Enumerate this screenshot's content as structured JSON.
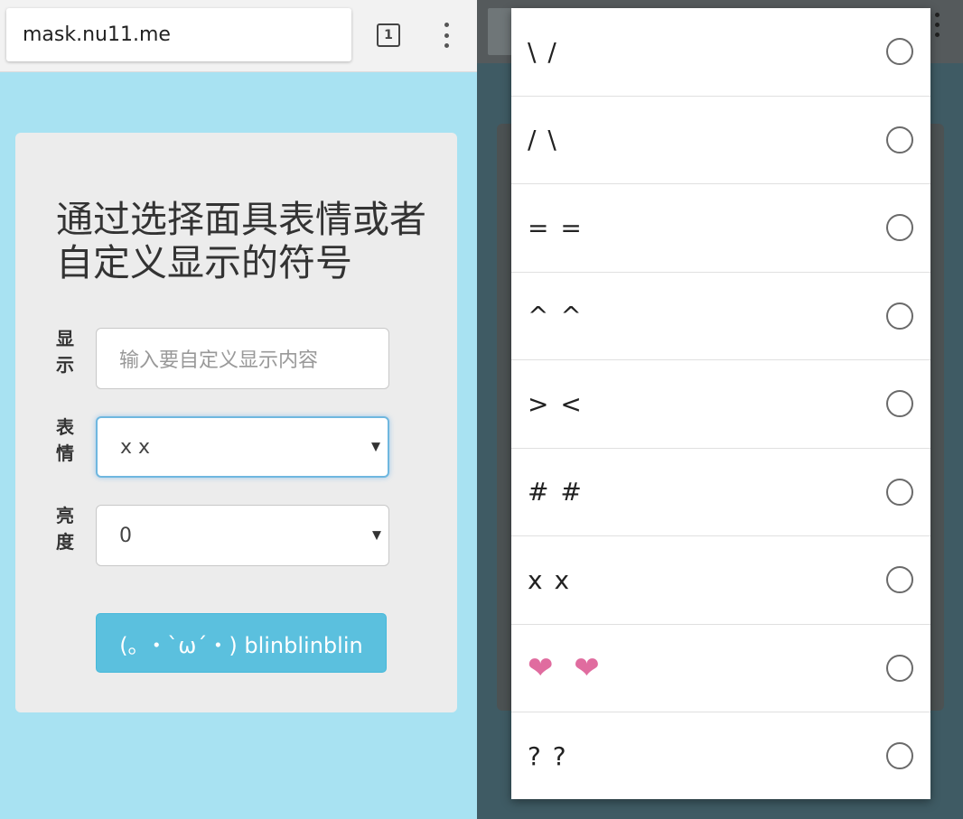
{
  "browser": {
    "url": "mask.nu11.me",
    "tab_count": "1"
  },
  "form": {
    "title": "通过选择面具表情或者自定义显示的符号",
    "display_label": "显示",
    "display_placeholder": "输入要自定义显示内容",
    "expression_label": "表情",
    "expression_value": "x x",
    "brightness_label": "亮度",
    "brightness_value": "0",
    "submit_label": "(｡ ・`ω´・) blinblinblin"
  },
  "dropdown": {
    "options": [
      {
        "label": "\\ /"
      },
      {
        "label": "/ \\"
      },
      {
        "label": "= ="
      },
      {
        "label": "^ ^"
      },
      {
        "label": "> <"
      },
      {
        "label": "# #"
      },
      {
        "label": "x x"
      },
      {
        "label": "❤ ❤"
      },
      {
        "label": "? ?"
      }
    ]
  },
  "colors": {
    "page_bg": "#a8e2f2",
    "button_bg": "#5bc0de",
    "heart": "#e06c9f"
  }
}
